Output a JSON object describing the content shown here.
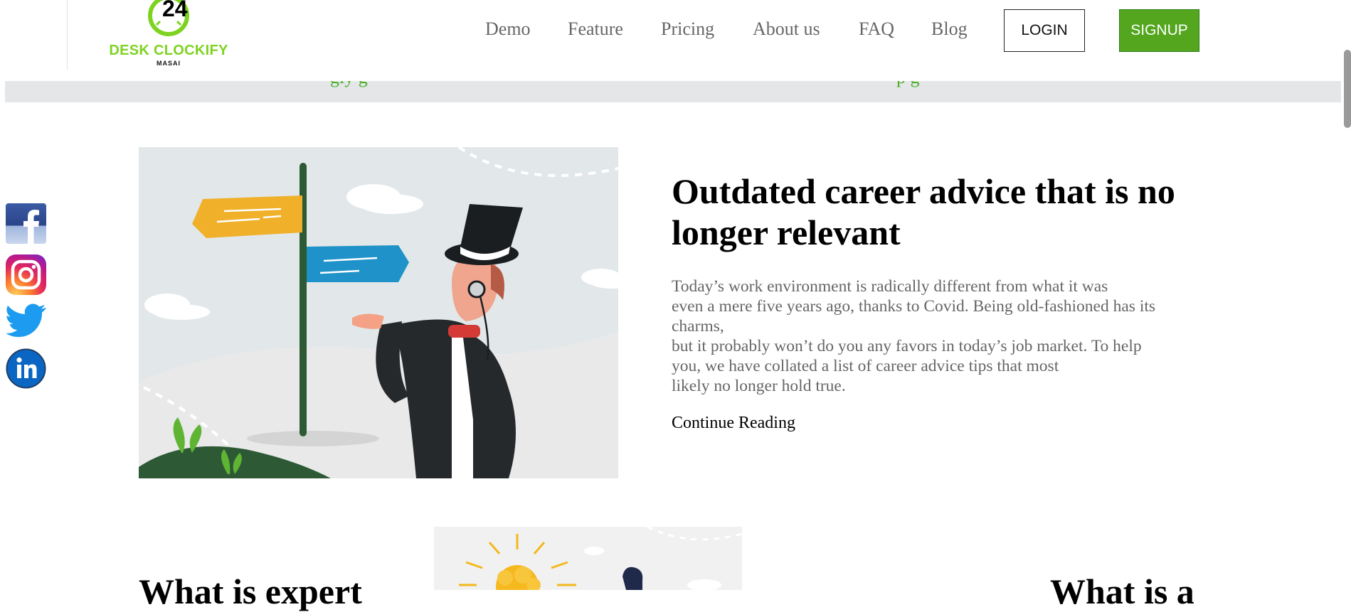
{
  "header": {
    "logo_number": "24",
    "logo_name": "DESK CLOCKIFY",
    "logo_sub": "MASAI",
    "nav": [
      "Demo",
      "Feature",
      "Pricing",
      "About us",
      "FAQ",
      "Blog"
    ],
    "login_label": "LOGIN",
    "signup_label": "SIGNUP"
  },
  "strip": {
    "left_fragment": "gly    g",
    "right_fragment": "p         g"
  },
  "social": {
    "icons": [
      "facebook-icon",
      "instagram-icon",
      "twitter-icon",
      "linkedin-icon"
    ]
  },
  "article": {
    "title_line1": "Outdated career advice that is no",
    "title_line2": "longer relevant",
    "excerpt": [
      "Today’s work environment is radically different from what it was",
      "even a mere five years ago, thanks to Covid. Being old-fashioned has its",
      "charms,",
      "but it probably won’t do you any favors in today’s job market. To help",
      "you, we have collated a list of career advice tips that most",
      "likely no longer hold true."
    ],
    "continue_label": "Continue Reading"
  },
  "next_row": {
    "left_title": "What is expert",
    "right_title": "What is a"
  },
  "colors": {
    "brand_green": "#7ed321",
    "signup_green": "#53a61e",
    "nav_text": "#666666",
    "strip_bg": "#e4e6e8"
  }
}
